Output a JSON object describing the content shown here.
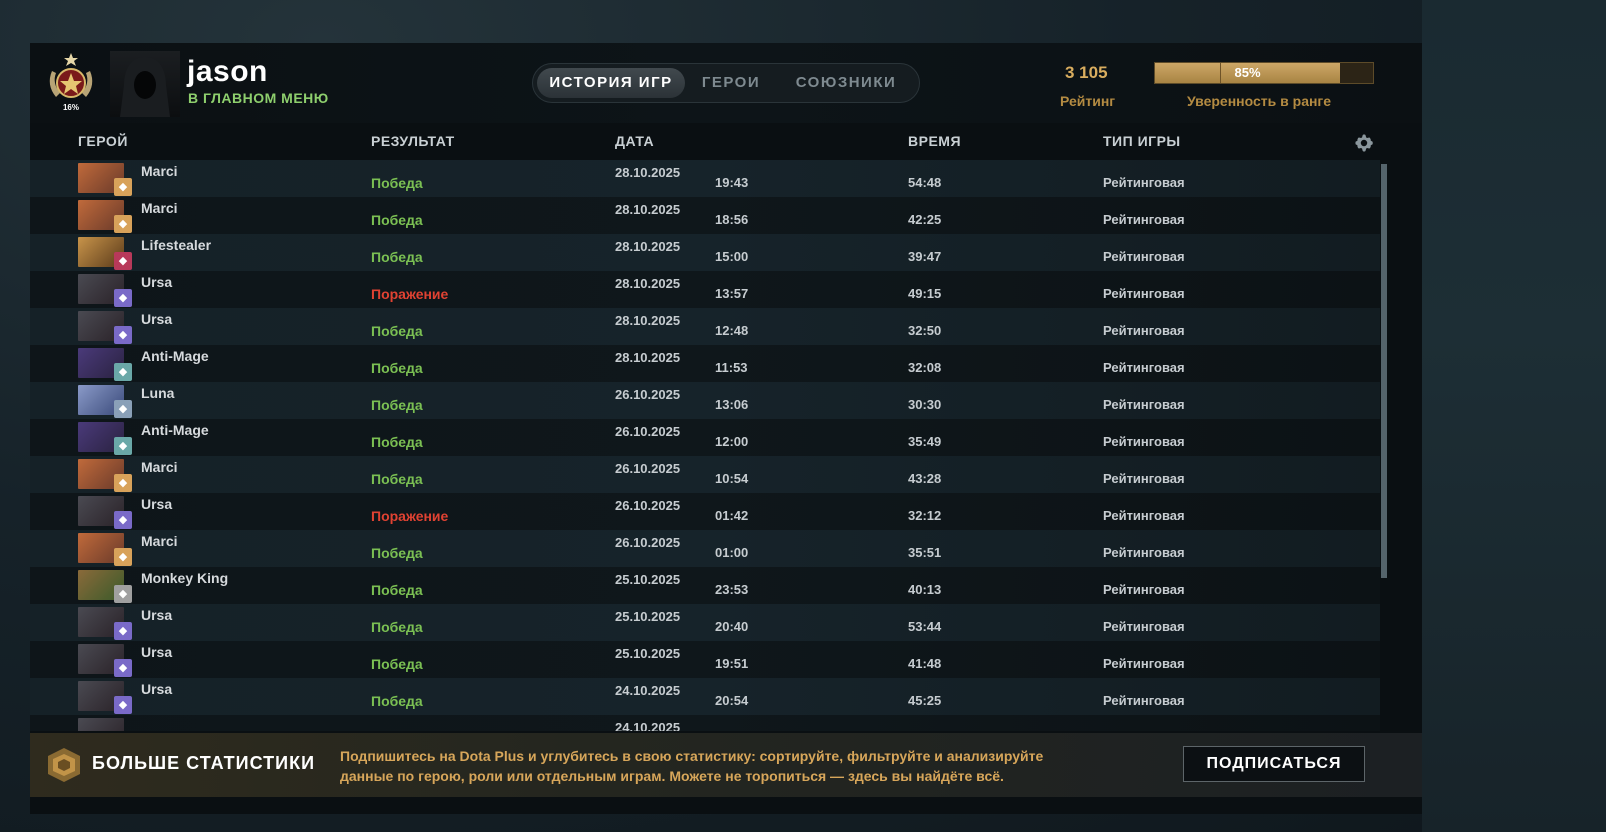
{
  "profile": {
    "name": "jason",
    "status": "В ГЛАВНОМ МЕНЮ",
    "rank_percent": "16%"
  },
  "tabs": [
    {
      "label": "ИСТОРИЯ ИГР",
      "active": true
    },
    {
      "label": "ГЕРОИ",
      "active": false
    },
    {
      "label": "СОЮЗНИКИ",
      "active": false
    }
  ],
  "rating": {
    "value": "3 105",
    "label": "Рейтинг",
    "confidence_text": "85%",
    "confidence_fraction": 0.85,
    "confidence_label": "Уверенность в ранге"
  },
  "columns": {
    "hero": "ГЕРОЙ",
    "result": "РЕЗУЛЬТАТ",
    "date": "ДАТА",
    "time": "ВРЕМЯ",
    "type": "ТИП ИГРЫ"
  },
  "matches": [
    {
      "hero": "Marci",
      "result": "Победа",
      "win": true,
      "date": "28.10.2025",
      "time": "19:43",
      "duration": "54:48",
      "type": "Рейтинговая"
    },
    {
      "hero": "Marci",
      "result": "Победа",
      "win": true,
      "date": "28.10.2025",
      "time": "18:56",
      "duration": "42:25",
      "type": "Рейтинговая"
    },
    {
      "hero": "Lifestealer",
      "result": "Победа",
      "win": true,
      "date": "28.10.2025",
      "time": "15:00",
      "duration": "39:47",
      "type": "Рейтинговая"
    },
    {
      "hero": "Ursa",
      "result": "Поражение",
      "win": false,
      "date": "28.10.2025",
      "time": "13:57",
      "duration": "49:15",
      "type": "Рейтинговая"
    },
    {
      "hero": "Ursa",
      "result": "Победа",
      "win": true,
      "date": "28.10.2025",
      "time": "12:48",
      "duration": "32:50",
      "type": "Рейтинговая"
    },
    {
      "hero": "Anti-Mage",
      "result": "Победа",
      "win": true,
      "date": "28.10.2025",
      "time": "11:53",
      "duration": "32:08",
      "type": "Рейтинговая"
    },
    {
      "hero": "Luna",
      "result": "Победа",
      "win": true,
      "date": "26.10.2025",
      "time": "13:06",
      "duration": "30:30",
      "type": "Рейтинговая"
    },
    {
      "hero": "Anti-Mage",
      "result": "Победа",
      "win": true,
      "date": "26.10.2025",
      "time": "12:00",
      "duration": "35:49",
      "type": "Рейтинговая"
    },
    {
      "hero": "Marci",
      "result": "Победа",
      "win": true,
      "date": "26.10.2025",
      "time": "10:54",
      "duration": "43:28",
      "type": "Рейтинговая"
    },
    {
      "hero": "Ursa",
      "result": "Поражение",
      "win": false,
      "date": "26.10.2025",
      "time": "01:42",
      "duration": "32:12",
      "type": "Рейтинговая"
    },
    {
      "hero": "Marci",
      "result": "Победа",
      "win": true,
      "date": "26.10.2025",
      "time": "01:00",
      "duration": "35:51",
      "type": "Рейтинговая"
    },
    {
      "hero": "Monkey King",
      "result": "Победа",
      "win": true,
      "date": "25.10.2025",
      "time": "23:53",
      "duration": "40:13",
      "type": "Рейтинговая"
    },
    {
      "hero": "Ursa",
      "result": "Победа",
      "win": true,
      "date": "25.10.2025",
      "time": "20:40",
      "duration": "53:44",
      "type": "Рейтинговая"
    },
    {
      "hero": "Ursa",
      "result": "Победа",
      "win": true,
      "date": "25.10.2025",
      "time": "19:51",
      "duration": "41:48",
      "type": "Рейтинговая"
    },
    {
      "hero": "Ursa",
      "result": "Победа",
      "win": true,
      "date": "24.10.2025",
      "time": "20:54",
      "duration": "45:25",
      "type": "Рейтинговая"
    },
    {
      "hero": "",
      "result": "",
      "win": true,
      "date": "24.10.2025",
      "time": "",
      "duration": "",
      "type": ""
    }
  ],
  "hero_colors": {
    "Marci": [
      "#c06a3b",
      "#6a3a2a",
      "#d8a25a"
    ],
    "Lifestealer": [
      "#c8944a",
      "#5a3a1a",
      "#b8395a"
    ],
    "Ursa": [
      "#4a4a52",
      "#2a2228",
      "#7a6ac8"
    ],
    "Anti-Mage": [
      "#4a3a7a",
      "#2a2240",
      "#6aa8a8"
    ],
    "Luna": [
      "#8a9ac8",
      "#3a4a7a",
      "#8aa0b8"
    ],
    "Monkey King": [
      "#8a6a3a",
      "#3a5a2a",
      "#a0a0a0"
    ],
    "": [
      "#4a4a52",
      "#2a2228",
      "#7a6ac8"
    ]
  },
  "footer": {
    "title": "БОЛЬШЕ СТАТИСТИКИ",
    "line1": "Подпишитесь на Dota Plus и углубитесь в свою статистику: сортируйте, фильтруйте и анализируйте",
    "line2": "данные по герою, роли или отдельным играм. Можете не торопиться — здесь вы найдёте всё.",
    "button": "ПОДПИСАТЬСЯ"
  }
}
